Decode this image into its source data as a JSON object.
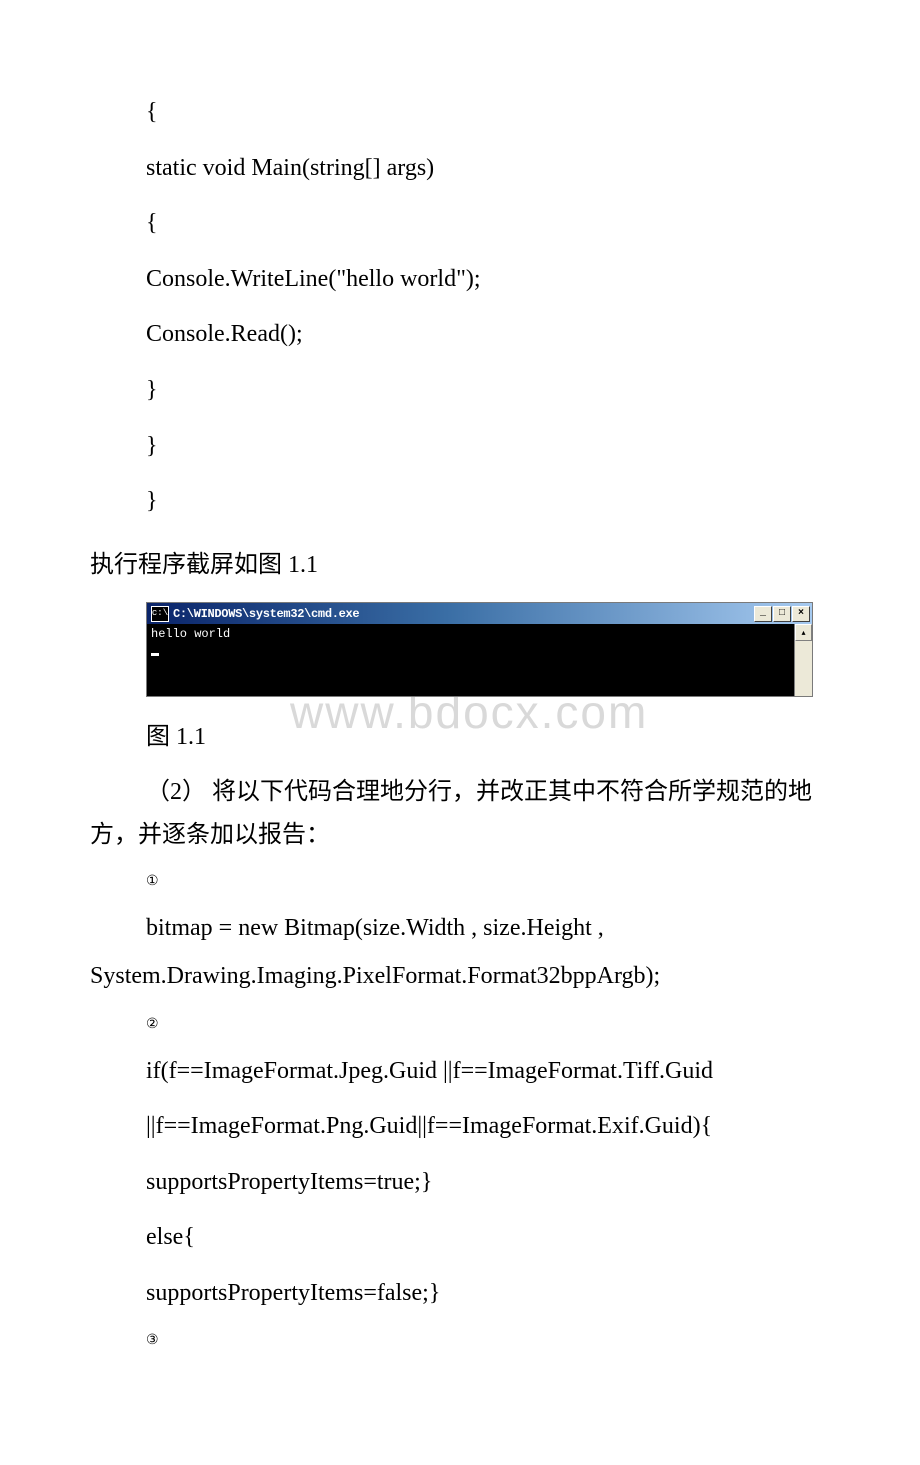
{
  "codeBlock1": {
    "l1": "{",
    "l2": " static void Main(string[] args)",
    "l3": " {",
    "l4": " Console.WriteLine(\"hello world\");",
    "l5": " Console.Read();",
    "l6": " }",
    "l7": " }",
    "l8": "}"
  },
  "caption1": "执行程序截屏如图 1.1",
  "cmd": {
    "title": "C:\\WINDOWS\\system32\\cmd.exe",
    "output": "hello world"
  },
  "figLabel": " 图 1.1",
  "watermark": "www.bdocx.com",
  "task2": "（2） 将以下代码合理地分行，并改正其中不符合所学规范的地方，并逐条加以报告：",
  "num1": "①",
  "code1a": "bitmap = new Bitmap(size.Width , size.Height ,",
  "code1b": "System.Drawing.Imaging.PixelFormat.Format32bppArgb);",
  "num2": "②",
  "code2": {
    "l1": "if(f==ImageFormat.Jpeg.Guid ||f==ImageFormat.Tiff.Guid",
    "l2": "||f==ImageFormat.Png.Guid||f==ImageFormat.Exif.Guid){",
    "l3": " supportsPropertyItems=true;}",
    "l4": " else{",
    "l5": " supportsPropertyItems=false;}"
  },
  "num3": "③"
}
